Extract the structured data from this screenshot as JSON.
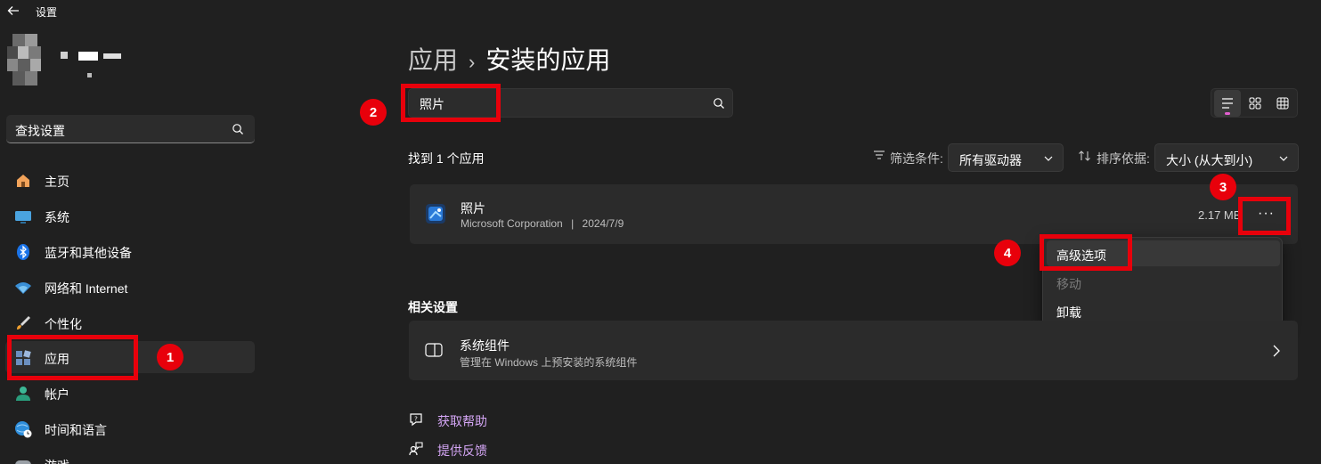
{
  "window": {
    "title": "设置"
  },
  "sidebar": {
    "search_placeholder": "查找设置",
    "items": [
      {
        "label": "主页",
        "icon": "home-icon"
      },
      {
        "label": "系统",
        "icon": "monitor-icon"
      },
      {
        "label": "蓝牙和其他设备",
        "icon": "bluetooth-icon"
      },
      {
        "label": "网络和 Internet",
        "icon": "wifi-icon"
      },
      {
        "label": "个性化",
        "icon": "brush-icon"
      },
      {
        "label": "应用",
        "icon": "apps-icon",
        "active": true
      },
      {
        "label": "帐户",
        "icon": "account-icon"
      },
      {
        "label": "时间和语言",
        "icon": "globe-clock-icon"
      },
      {
        "label": "游戏",
        "icon": "gamepad-icon"
      }
    ]
  },
  "header": {
    "breadcrumb_parent": "应用",
    "breadcrumb_separator": "›",
    "breadcrumb_current": "安装的应用"
  },
  "search": {
    "value": "照片"
  },
  "view_modes": [
    {
      "name": "list",
      "selected": true
    },
    {
      "name": "tiles"
    },
    {
      "name": "grid"
    }
  ],
  "results": {
    "found_text": "找到 1 个应用",
    "filter_label": "筛选条件:",
    "filter_value": "所有驱动器",
    "sort_label": "排序依据:",
    "sort_value": "大小 (从大到小)"
  },
  "app": {
    "name": "照片",
    "publisher": "Microsoft Corporation",
    "separator": "|",
    "date": "2024/7/9",
    "size": "2.17 MB",
    "more_label": "···"
  },
  "context_menu": {
    "items": [
      {
        "label": "高级选项",
        "state": "hover"
      },
      {
        "label": "移动",
        "state": "disabled"
      },
      {
        "label": "卸载",
        "state": "normal"
      }
    ]
  },
  "related": {
    "header": "相关设置",
    "title": "系统组件",
    "subtitle": "管理在 Windows 上预安装的系统组件"
  },
  "help": {
    "get_help": "获取帮助",
    "feedback": "提供反馈"
  },
  "annotations": [
    "1",
    "2",
    "3",
    "4"
  ],
  "colors": {
    "accent_link": "#d4a6f5",
    "annotation_red": "#e8000b",
    "background": "#202020"
  }
}
